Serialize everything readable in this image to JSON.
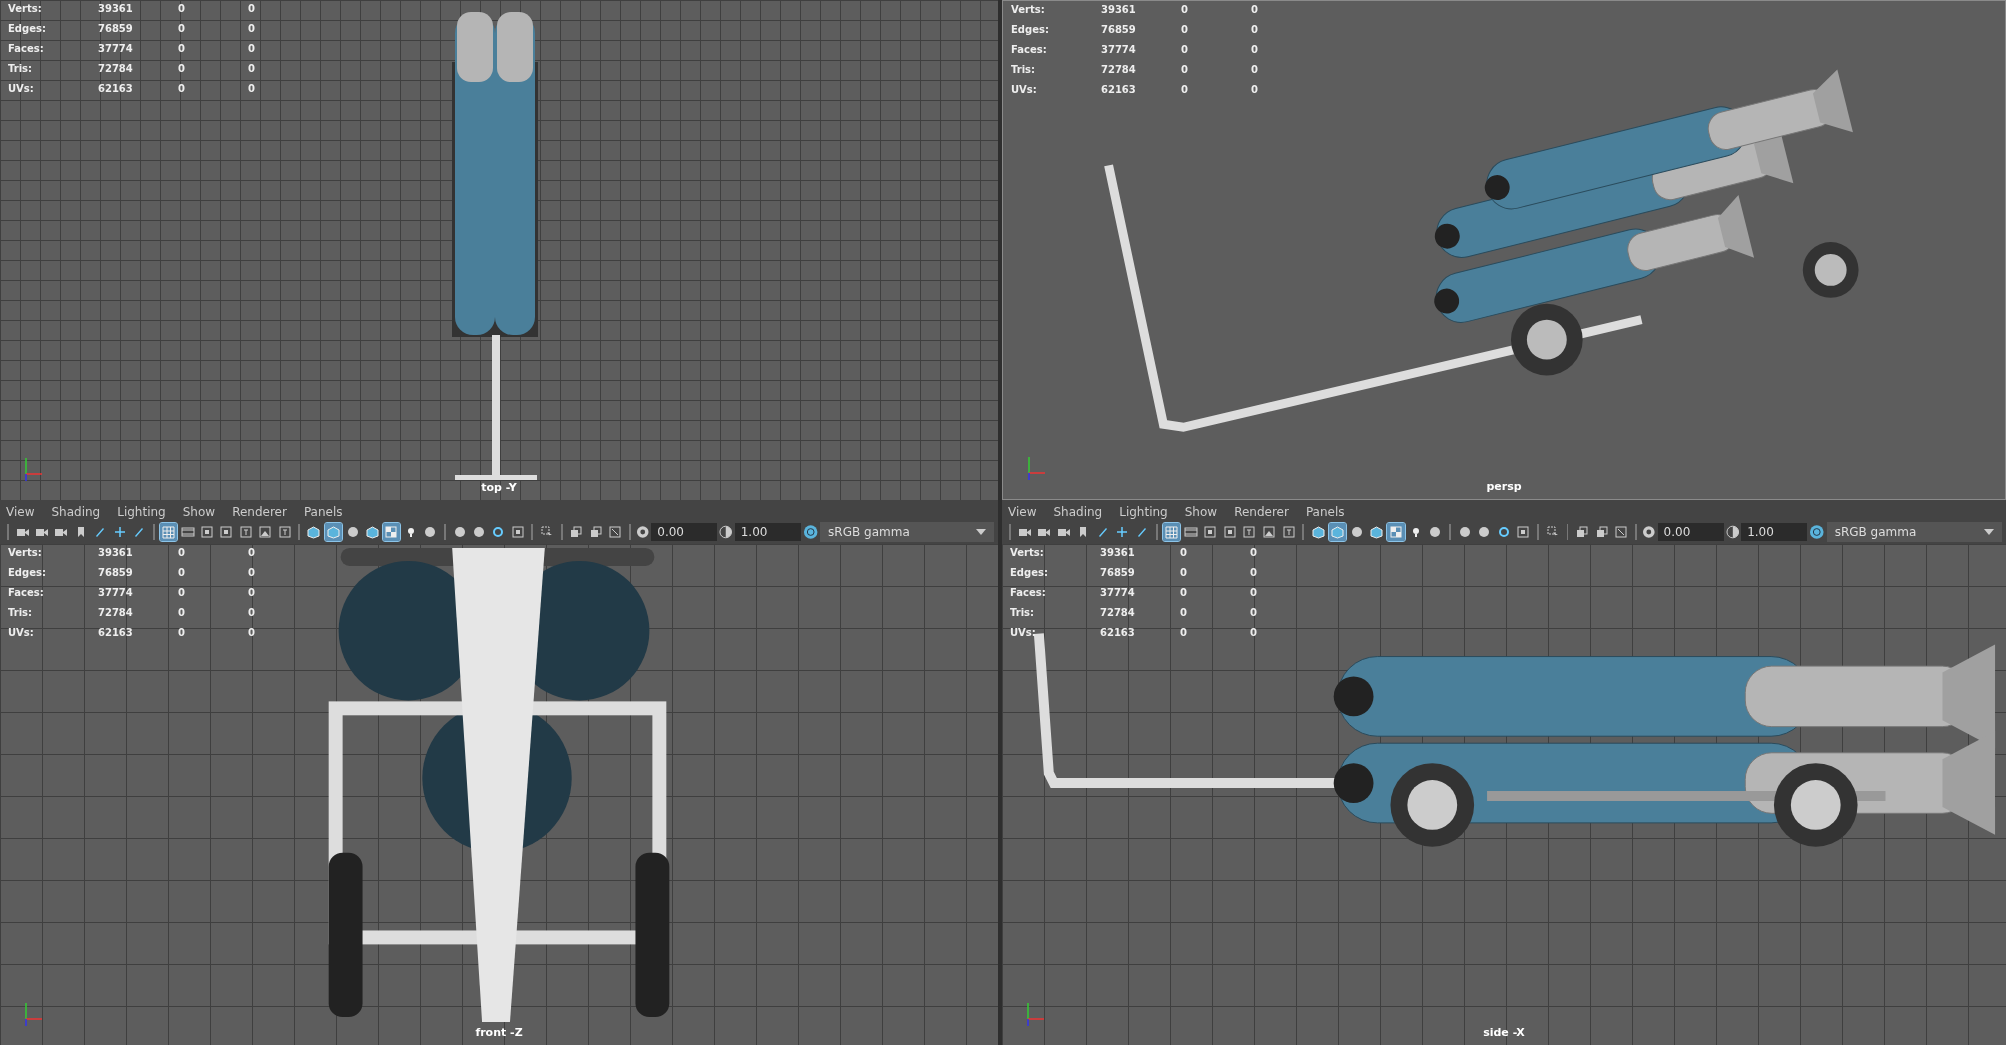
{
  "panes": [
    {
      "kind": "top",
      "camera": "top -Y",
      "stats": [
        {
          "label": "Verts:",
          "values": [
            "39361",
            "0",
            "0"
          ]
        },
        {
          "label": "Edges:",
          "values": [
            "76859",
            "0",
            "0"
          ]
        },
        {
          "label": "Faces:",
          "values": [
            "37774",
            "0",
            "0"
          ]
        },
        {
          "label": "Tris:",
          "values": [
            "72784",
            "0",
            "0"
          ]
        },
        {
          "label": "UVs:",
          "values": [
            "62163",
            "0",
            "0"
          ]
        }
      ]
    },
    {
      "kind": "persp",
      "camera": "persp",
      "stats": [
        {
          "label": "Verts:",
          "values": [
            "39361",
            "0",
            "0"
          ]
        },
        {
          "label": "Edges:",
          "values": [
            "76859",
            "0",
            "0"
          ]
        },
        {
          "label": "Faces:",
          "values": [
            "37774",
            "0",
            "0"
          ]
        },
        {
          "label": "Tris:",
          "values": [
            "72784",
            "0",
            "0"
          ]
        },
        {
          "label": "UVs:",
          "values": [
            "62163",
            "0",
            "0"
          ]
        }
      ]
    },
    {
      "kind": "front",
      "camera": "front -Z",
      "menu": [
        "View",
        "Shading",
        "Lighting",
        "Show",
        "Renderer",
        "Panels"
      ],
      "toolbar": [
        [
          {
            "kind": "camera",
            "selected": false
          },
          {
            "kind": "camera",
            "selected": false
          },
          {
            "kind": "camera",
            "selected": false
          },
          {
            "kind": "bookmark",
            "selected": false
          },
          {
            "kind": "pen",
            "selected": false
          },
          {
            "kind": "move",
            "selected": false
          },
          {
            "kind": "pen",
            "selected": false
          }
        ],
        [
          {
            "kind": "grid",
            "selected": true
          },
          {
            "kind": "film",
            "selected": false
          },
          {
            "kind": "square",
            "selected": false
          },
          {
            "kind": "square",
            "selected": false
          },
          {
            "kind": "frame",
            "selected": false
          },
          {
            "kind": "image",
            "selected": false
          },
          {
            "kind": "frame",
            "selected": false
          }
        ],
        [
          {
            "kind": "cube",
            "selected": false
          },
          {
            "kind": "cube",
            "selected": true
          },
          {
            "kind": "sphere",
            "selected": false
          },
          {
            "kind": "cube",
            "selected": false
          },
          {
            "kind": "checker",
            "selected": true
          },
          {
            "kind": "light",
            "selected": false
          },
          {
            "kind": "sphere",
            "selected": false
          }
        ],
        [
          {
            "kind": "sphere",
            "selected": false
          },
          {
            "kind": "sphere",
            "selected": false
          },
          {
            "kind": "cycle",
            "selected": false
          },
          {
            "kind": "square",
            "selected": false
          }
        ],
        [
          {
            "kind": "select",
            "selected": false
          }
        ],
        [
          {
            "kind": "copy",
            "selected": false
          },
          {
            "kind": "copy",
            "selected": false
          },
          {
            "kind": "resize",
            "selected": false
          }
        ]
      ],
      "exposure": "0.00",
      "gamma": "1.00",
      "colorspace": "sRGB gamma",
      "stats": [
        {
          "label": "Verts:",
          "values": [
            "39361",
            "0",
            "0"
          ]
        },
        {
          "label": "Edges:",
          "values": [
            "76859",
            "0",
            "0"
          ]
        },
        {
          "label": "Faces:",
          "values": [
            "37774",
            "0",
            "0"
          ]
        },
        {
          "label": "Tris:",
          "values": [
            "72784",
            "0",
            "0"
          ]
        },
        {
          "label": "UVs:",
          "values": [
            "62163",
            "0",
            "0"
          ]
        }
      ]
    },
    {
      "kind": "side",
      "camera": "side -X",
      "menu": [
        "View",
        "Shading",
        "Lighting",
        "Show",
        "Renderer",
        "Panels"
      ],
      "toolbar": [
        [
          {
            "kind": "camera",
            "selected": false
          },
          {
            "kind": "camera",
            "selected": false
          },
          {
            "kind": "camera",
            "selected": false
          },
          {
            "kind": "bookmark",
            "selected": false
          },
          {
            "kind": "pen",
            "selected": false
          },
          {
            "kind": "move",
            "selected": false
          },
          {
            "kind": "pen",
            "selected": false
          }
        ],
        [
          {
            "kind": "grid",
            "selected": true
          },
          {
            "kind": "film",
            "selected": false
          },
          {
            "kind": "square",
            "selected": false
          },
          {
            "kind": "square",
            "selected": false
          },
          {
            "kind": "frame",
            "selected": false
          },
          {
            "kind": "image",
            "selected": false
          },
          {
            "kind": "frame",
            "selected": false
          }
        ],
        [
          {
            "kind": "cube",
            "selected": false
          },
          {
            "kind": "cube",
            "selected": true
          },
          {
            "kind": "sphere",
            "selected": false
          },
          {
            "kind": "cube",
            "selected": false
          },
          {
            "kind": "checker",
            "selected": true
          },
          {
            "kind": "light",
            "selected": false
          },
          {
            "kind": "sphere",
            "selected": false
          }
        ],
        [
          {
            "kind": "sphere",
            "selected": false
          },
          {
            "kind": "sphere",
            "selected": false
          },
          {
            "kind": "cycle",
            "selected": false
          },
          {
            "kind": "square",
            "selected": false
          }
        ],
        [
          {
            "kind": "select",
            "selected": false
          }
        ],
        [
          {
            "kind": "copy",
            "selected": false
          },
          {
            "kind": "copy",
            "selected": false
          },
          {
            "kind": "resize",
            "selected": false
          }
        ]
      ],
      "exposure": "0.00",
      "gamma": "1.00",
      "colorspace": "sRGB gamma",
      "stats": [
        {
          "label": "Verts:",
          "values": [
            "39361",
            "0",
            "0"
          ]
        },
        {
          "label": "Edges:",
          "values": [
            "76859",
            "0",
            "0"
          ]
        },
        {
          "label": "Faces:",
          "values": [
            "37774",
            "0",
            "0"
          ]
        },
        {
          "label": "Tris:",
          "values": [
            "72784",
            "0",
            "0"
          ]
        },
        {
          "label": "UVs:",
          "values": [
            "62163",
            "0",
            "0"
          ]
        }
      ]
    }
  ]
}
